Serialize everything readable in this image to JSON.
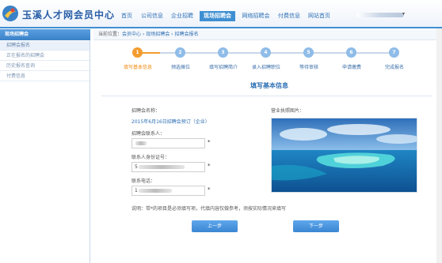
{
  "header": {
    "site_title": "玉溪人才网会员中心",
    "nav": [
      "首页",
      "公司信息",
      "企业招聘",
      "现场招聘会",
      "网络招聘会",
      "付费信息",
      "网站首页"
    ],
    "nav_active_index": 3
  },
  "sidebar": {
    "title": "现场招聘会",
    "items": [
      "招聘会报名",
      "正在报名的招聘会",
      "历史报名查询",
      "付费信息"
    ],
    "active_index": 0
  },
  "breadcrumb": {
    "prefix": "当前位置：",
    "items": [
      "会员中心",
      "现场招聘会",
      "招聘会报名"
    ],
    "sep": " › "
  },
  "steps": [
    {
      "num": "1",
      "label": "填写基本信息"
    },
    {
      "num": "2",
      "label": "预选摊位"
    },
    {
      "num": "3",
      "label": "填写招聘简介"
    },
    {
      "num": "4",
      "label": "录入招聘职位"
    },
    {
      "num": "5",
      "label": "等待审核"
    },
    {
      "num": "6",
      "label": "申请缴费"
    },
    {
      "num": "7",
      "label": "完成报名"
    }
  ],
  "active_step": 0,
  "form": {
    "section_title": "填写基本信息",
    "fair_name_label": "招聘会名称：",
    "fair_name_value": "2015年6月16日招聘会预订（企业）",
    "contact_label": "招聘会联系人：",
    "contact_value": "",
    "id_label": "联系人身份证号：",
    "id_value": "5",
    "phone_label": "联系电话：",
    "phone_value": "1",
    "required_mark": "*",
    "license_label": "营业执照图片："
  },
  "note": "说明：带*的项目是必须填写项，代填内容仅做参考，须按实际情况来填写",
  "buttons": {
    "prev": "上一步",
    "next": "下一步"
  },
  "colors": {
    "accent": "#3f8fd2",
    "step_active": "#f39c2f",
    "link": "#2e6fb4"
  }
}
